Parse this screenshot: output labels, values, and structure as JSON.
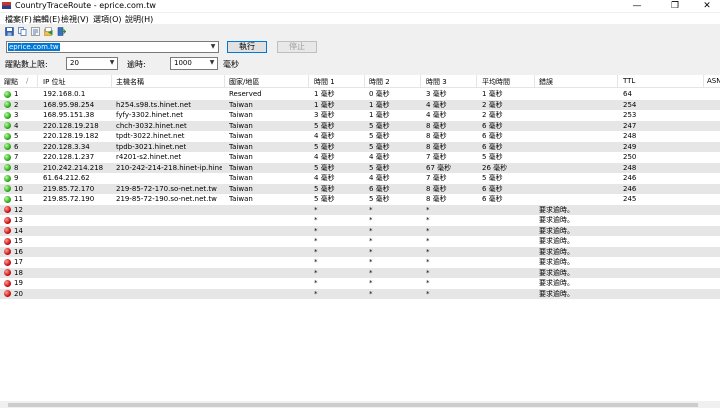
{
  "window": {
    "title": "CountryTraceRoute - eprice.com.tw",
    "minimize": "—",
    "maximize": "❐",
    "close": "✕"
  },
  "menu": [
    {
      "label": "檔案(F)"
    },
    {
      "label": "編輯(E)"
    },
    {
      "label": "檢視(V)"
    },
    {
      "label": "選項(O)"
    },
    {
      "label": "說明(H)"
    }
  ],
  "toolbar_icons": [
    "save-icon",
    "copy-icon",
    "properties-icon",
    "export-icon",
    "exit-icon"
  ],
  "controls": {
    "url_value": "eprice.com.tw",
    "run_label": "執行",
    "stop_label": "停止",
    "max_hops_label": "躍點數上限:",
    "max_hops_value": "20",
    "timeout_label": "逾時:",
    "timeout_value": "1000",
    "timeout_unit": "毫秒"
  },
  "columns": [
    "躍點",
    "IP 位址",
    "主機名稱",
    "國家/地區",
    "時間 1",
    "時間 2",
    "時間 3",
    "平均時間",
    "錯誤",
    "TTL",
    "ASN"
  ],
  "sort_indicator": "∕",
  "rows": [
    {
      "status": "green",
      "hop": "1",
      "ip": "192.168.0.1",
      "host": "",
      "country": "Reserved",
      "t1": "1 毫秒",
      "t2": "0 毫秒",
      "t3": "3 毫秒",
      "avg": "1 毫秒",
      "err": "",
      "ttl": "64"
    },
    {
      "status": "green",
      "hop": "2",
      "ip": "168.95.98.254",
      "host": "h254.s98.ts.hinet.net",
      "country": "Taiwan",
      "t1": "1 毫秒",
      "t2": "1 毫秒",
      "t3": "4 毫秒",
      "avg": "2 毫秒",
      "err": "",
      "ttl": "254"
    },
    {
      "status": "green",
      "hop": "3",
      "ip": "168.95.151.38",
      "host": "fyfy-3302.hinet.net",
      "country": "Taiwan",
      "t1": "3 毫秒",
      "t2": "1 毫秒",
      "t3": "4 毫秒",
      "avg": "2 毫秒",
      "err": "",
      "ttl": "253"
    },
    {
      "status": "green",
      "hop": "4",
      "ip": "220.128.19.218",
      "host": "chch-3032.hinet.net",
      "country": "Taiwan",
      "t1": "5 毫秒",
      "t2": "5 毫秒",
      "t3": "8 毫秒",
      "avg": "6 毫秒",
      "err": "",
      "ttl": "247"
    },
    {
      "status": "green",
      "hop": "5",
      "ip": "220.128.19.182",
      "host": "tpdt-3022.hinet.net",
      "country": "Taiwan",
      "t1": "4 毫秒",
      "t2": "5 毫秒",
      "t3": "8 毫秒",
      "avg": "6 毫秒",
      "err": "",
      "ttl": "248"
    },
    {
      "status": "green",
      "hop": "6",
      "ip": "220.128.3.34",
      "host": "tpdb-3021.hinet.net",
      "country": "Taiwan",
      "t1": "5 毫秒",
      "t2": "5 毫秒",
      "t3": "8 毫秒",
      "avg": "6 毫秒",
      "err": "",
      "ttl": "249"
    },
    {
      "status": "green",
      "hop": "7",
      "ip": "220.128.1.237",
      "host": "r4201-s2.hinet.net",
      "country": "Taiwan",
      "t1": "4 毫秒",
      "t2": "4 毫秒",
      "t3": "7 毫秒",
      "avg": "5 毫秒",
      "err": "",
      "ttl": "250"
    },
    {
      "status": "green",
      "hop": "8",
      "ip": "210.242.214.218",
      "host": "210-242-214-218.hinet-ip.hinet...",
      "country": "Taiwan",
      "t1": "5 毫秒",
      "t2": "5 毫秒",
      "t3": "67 毫秒",
      "avg": "26 毫秒",
      "err": "",
      "ttl": "248"
    },
    {
      "status": "green",
      "hop": "9",
      "ip": "61.64.212.62",
      "host": "",
      "country": "Taiwan",
      "t1": "4 毫秒",
      "t2": "4 毫秒",
      "t3": "7 毫秒",
      "avg": "5 毫秒",
      "err": "",
      "ttl": "246"
    },
    {
      "status": "green",
      "hop": "10",
      "ip": "219.85.72.170",
      "host": "219-85-72-170.so-net.net.tw",
      "country": "Taiwan",
      "t1": "5 毫秒",
      "t2": "6 毫秒",
      "t3": "8 毫秒",
      "avg": "6 毫秒",
      "err": "",
      "ttl": "246"
    },
    {
      "status": "green",
      "hop": "11",
      "ip": "219.85.72.190",
      "host": "219-85-72-190.so-net.net.tw",
      "country": "Taiwan",
      "t1": "5 毫秒",
      "t2": "5 毫秒",
      "t3": "8 毫秒",
      "avg": "6 毫秒",
      "err": "",
      "ttl": "245"
    },
    {
      "status": "red",
      "hop": "12",
      "ip": "",
      "host": "",
      "country": "",
      "t1": "*",
      "t2": "*",
      "t3": "*",
      "avg": "",
      "err": "要求逾時。",
      "ttl": ""
    },
    {
      "status": "red",
      "hop": "13",
      "ip": "",
      "host": "",
      "country": "",
      "t1": "*",
      "t2": "*",
      "t3": "*",
      "avg": "",
      "err": "要求逾時。",
      "ttl": ""
    },
    {
      "status": "red",
      "hop": "14",
      "ip": "",
      "host": "",
      "country": "",
      "t1": "*",
      "t2": "*",
      "t3": "*",
      "avg": "",
      "err": "要求逾時。",
      "ttl": ""
    },
    {
      "status": "red",
      "hop": "15",
      "ip": "",
      "host": "",
      "country": "",
      "t1": "*",
      "t2": "*",
      "t3": "*",
      "avg": "",
      "err": "要求逾時。",
      "ttl": ""
    },
    {
      "status": "red",
      "hop": "16",
      "ip": "",
      "host": "",
      "country": "",
      "t1": "*",
      "t2": "*",
      "t3": "*",
      "avg": "",
      "err": "要求逾時。",
      "ttl": ""
    },
    {
      "status": "red",
      "hop": "17",
      "ip": "",
      "host": "",
      "country": "",
      "t1": "*",
      "t2": "*",
      "t3": "*",
      "avg": "",
      "err": "要求逾時。",
      "ttl": ""
    },
    {
      "status": "red",
      "hop": "18",
      "ip": "",
      "host": "",
      "country": "",
      "t1": "*",
      "t2": "*",
      "t3": "*",
      "avg": "",
      "err": "要求逾時。",
      "ttl": ""
    },
    {
      "status": "red",
      "hop": "19",
      "ip": "",
      "host": "",
      "country": "",
      "t1": "*",
      "t2": "*",
      "t3": "*",
      "avg": "",
      "err": "要求逾時。",
      "ttl": ""
    },
    {
      "status": "red",
      "hop": "20",
      "ip": "",
      "host": "",
      "country": "",
      "t1": "*",
      "t2": "*",
      "t3": "*",
      "avg": "",
      "err": "要求逾時。",
      "ttl": ""
    }
  ]
}
